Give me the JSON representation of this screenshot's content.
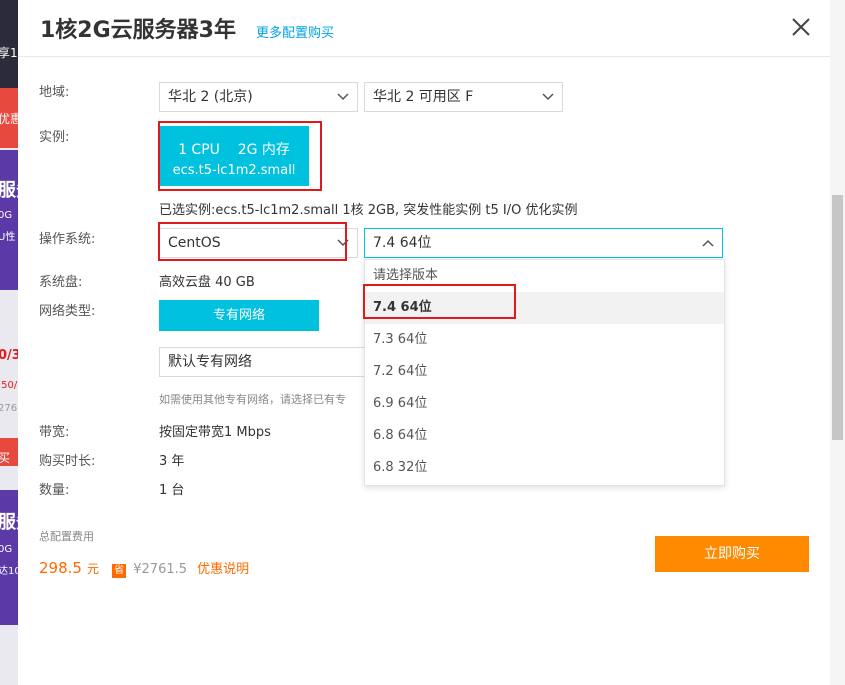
{
  "background": {
    "texts": [
      "享1",
      "优惠",
      "服务",
      "0G",
      "U性",
      "0/3",
      ".50/",
      "276",
      "买",
      "服务",
      "0G",
      "达10"
    ]
  },
  "header": {
    "title": "1核2G云服务器3年",
    "more_link": "更多配置购买"
  },
  "form": {
    "region": {
      "label": "地域:",
      "region_value": "华北 2 (北京)",
      "zone_value": "华北 2 可用区 F"
    },
    "instance": {
      "label": "实例:",
      "cpu": "1 CPU",
      "mem": "2G 内存",
      "spec": "ecs.t5-lc1m2.small",
      "selected_desc": "已选实例:ecs.t5-lc1m2.small 1核 2GB, 突发性能实例 t5 I/O 优化实例"
    },
    "os": {
      "label": "操作系统:",
      "os_value": "CentOS",
      "version_value": "7.4 64位",
      "options": [
        "请选择版本",
        "7.4 64位",
        "7.3 64位",
        "7.2 64位",
        "6.9 64位",
        "6.8 64位",
        "6.8 32位"
      ],
      "selected_index": 1
    },
    "disk": {
      "label": "系统盘:",
      "value": "高效云盘 40 GB"
    },
    "network": {
      "label": "网络类型:",
      "button": "专有网络",
      "vpc_value": "默认专有网络",
      "hint": "如需使用其他专有网络，请选择已有专"
    },
    "bandwidth": {
      "label": "带宽:",
      "value": "按固定带宽1 Mbps"
    },
    "duration": {
      "label": "购买时长:",
      "value": "3 年"
    },
    "quantity": {
      "label": "数量:",
      "value": "1 台"
    }
  },
  "footer": {
    "total_label": "总配置费用",
    "price": "298.5",
    "unit": "元",
    "save_badge": "省",
    "original_price": "¥2761.5",
    "discount_link": "优惠说明",
    "buy_button": "立即购买"
  },
  "colors": {
    "accent": "#00c1de",
    "link": "#00a2e8",
    "price": "#ff6a00",
    "buy": "#ff8a00",
    "highlight_box": "#e01a1a"
  }
}
